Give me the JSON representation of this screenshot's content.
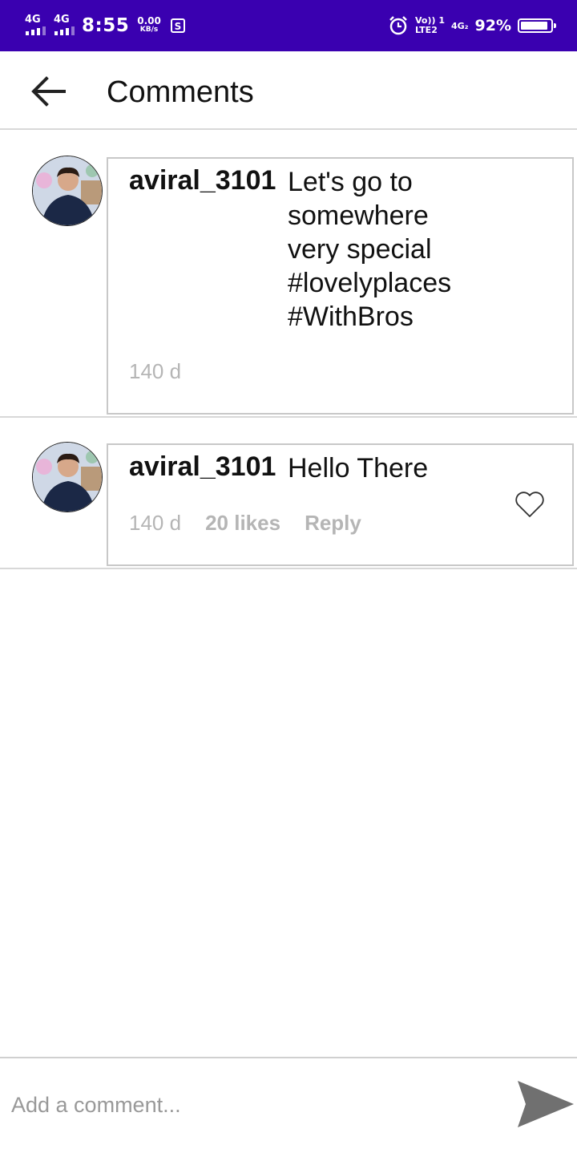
{
  "status_bar": {
    "signal1_label": "4G",
    "signal2_label": "4G",
    "time": "8:55",
    "speed_value": "0.00",
    "speed_unit": "KB/s",
    "volte_top": "Vo)) 1",
    "volte_bottom": "LTE2",
    "network2": "4G₂",
    "battery_percent": "92%",
    "battery_level": 0.92,
    "background_color": "#3a00b0"
  },
  "app_bar": {
    "title": "Comments",
    "back_icon": "arrow-left-icon"
  },
  "comments": [
    {
      "username": "aviral_3101",
      "text": "Let's go to\nsomewhere\nvery special\n#lovelyplaces\n#WithBros",
      "age": "140 d",
      "likes": "",
      "reply": ""
    },
    {
      "username": "aviral_3101",
      "text": "Hello There",
      "age": "140 d",
      "likes": "20 likes",
      "reply": "Reply",
      "like_icon": "heart-outline-icon"
    }
  ],
  "composer": {
    "placeholder": "Add a comment...",
    "send_icon": "send-icon",
    "send_color": "#707070"
  }
}
